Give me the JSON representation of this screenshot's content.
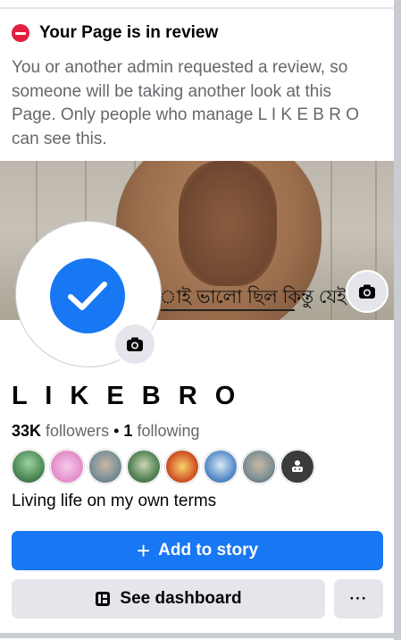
{
  "review_banner": {
    "title": "Your Page is in review",
    "message": "You or another admin requested a review, so someone will be taking another look at this Page. Only people who manage L I K E   B R O can see this."
  },
  "cover": {
    "overlay_text": "াই ভালো ছিল কিন্তু যেই"
  },
  "profile": {
    "name": "L I K E   B R O",
    "followers_count": "33K",
    "followers_label": "followers",
    "separator": "•",
    "following_count": "1",
    "following_label": "following",
    "bio": "Living life on my own terms",
    "follower_avatars": [
      {
        "color": "#6aa06a"
      },
      {
        "color": "#e6a6d6"
      },
      {
        "color": "#8aa0a8"
      },
      {
        "color": "#4f7d52"
      },
      {
        "color": "#d35a2a"
      },
      {
        "color": "#5b8ec9"
      },
      {
        "color": "#7d8f95"
      },
      {
        "icon": "more-icon"
      }
    ]
  },
  "actions": {
    "add_story_label": "Add to story",
    "dashboard_label": "See dashboard",
    "more_label": "···"
  },
  "colors": {
    "primary": "#1877f2",
    "secondary_button": "#e4e6eb",
    "alert_red": "#e41e3f",
    "muted_text": "#65676b"
  }
}
